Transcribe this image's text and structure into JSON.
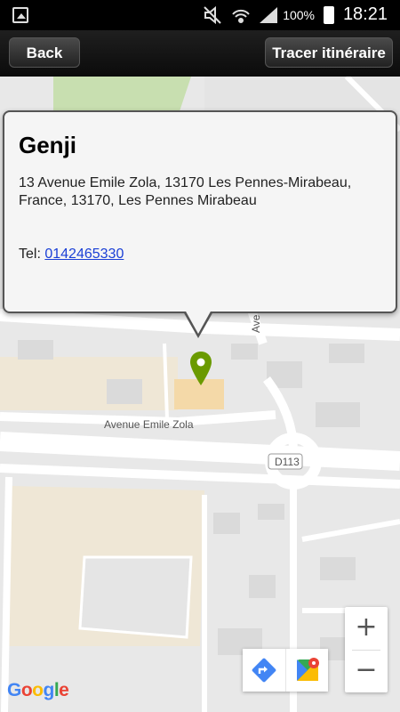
{
  "status_bar": {
    "battery_percent": "100%",
    "time": "18:21",
    "icons": [
      "gallery-icon",
      "mute-icon",
      "wifi-icon",
      "signal-icon",
      "battery-icon"
    ]
  },
  "toolbar": {
    "back_label": "Back",
    "route_label": "Tracer itinéraire"
  },
  "place": {
    "name": "Genji",
    "address": "13 Avenue Emile Zola, 13170 Les Pennes-Mirabeau, France, 13170, Les Pennes Mirabeau",
    "tel_label": "Tel:",
    "tel_number": "0142465330"
  },
  "map": {
    "street_main": "Avenue Emile Zola",
    "road_badge": "D113",
    "street_vertical": "Ave",
    "marker_color": "#6a9a00",
    "zoom_in": "+",
    "zoom_out": "−",
    "attribution": "Google"
  }
}
